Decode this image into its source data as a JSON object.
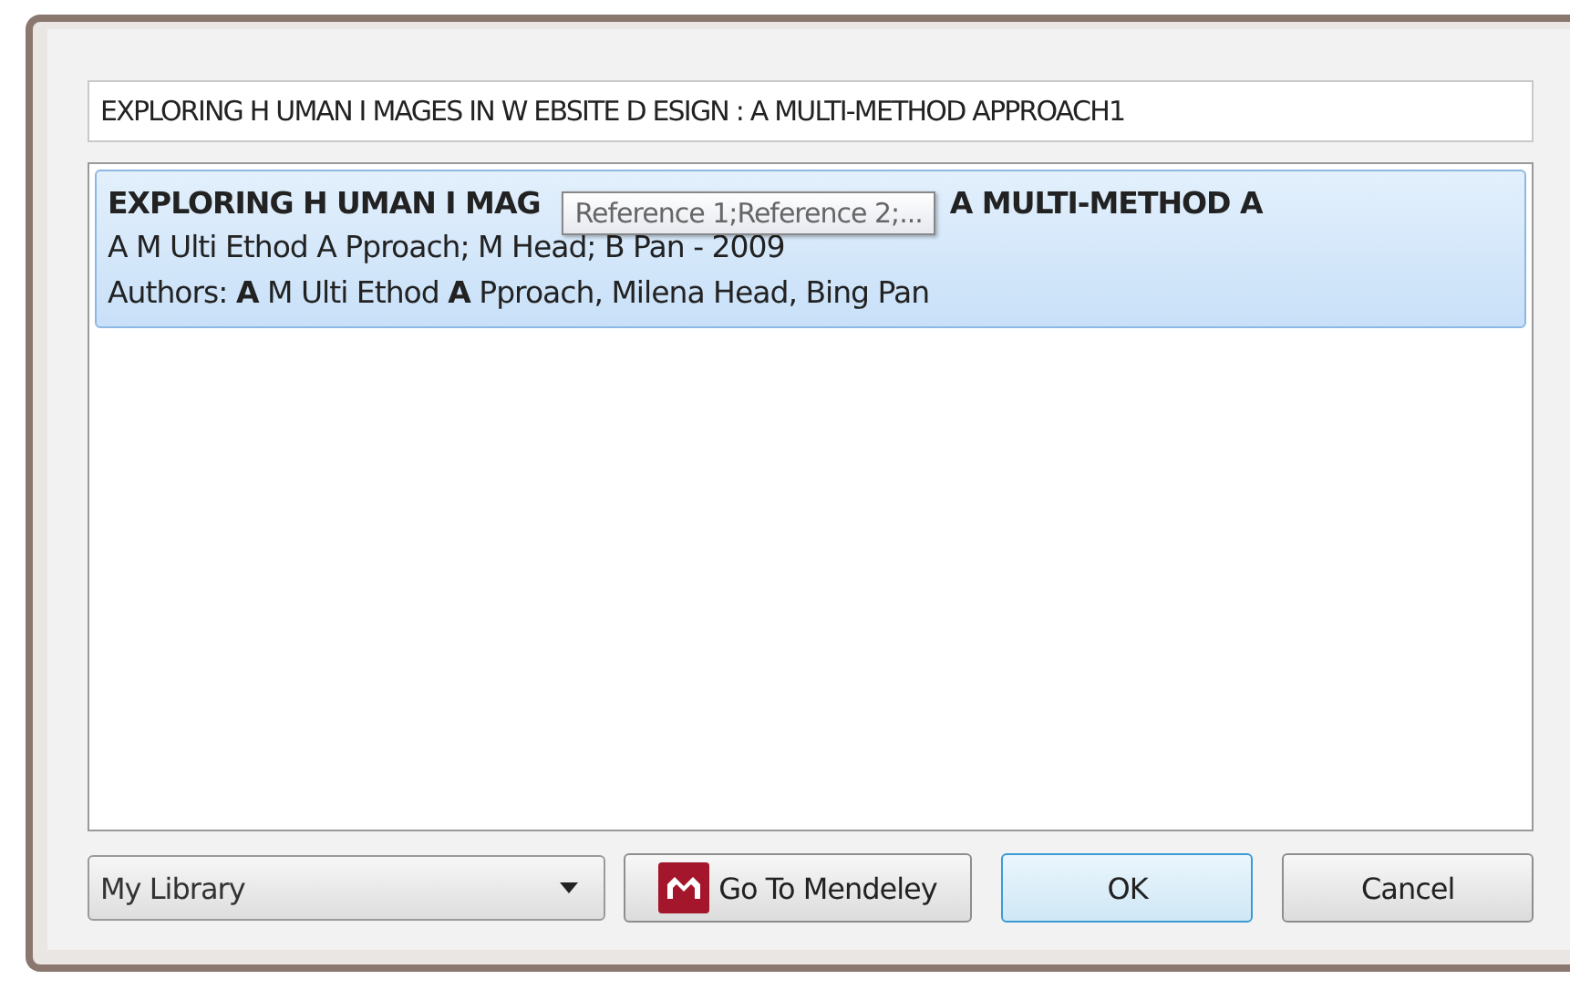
{
  "search_field": {
    "value": "EXPLORING H UMAN I MAGES IN W EBSITE D ESIGN : A MULTI-METHOD APPROACH1"
  },
  "results": [
    {
      "title_parts": [
        "EXPLORING H UMAN I MAG",
        "A MULTI-METHOD A"
      ],
      "citation": "A M Ulti Ethod A Pproach; M Head; B Pan - 2009",
      "authors": "Authors: **A** M Ulti Ethod **A** Pproach, Milena Head, Bing Pan",
      "selected": true
    }
  ],
  "tooltip": "Reference 1;Reference 2;...",
  "library_dropdown": {
    "value": "My Library"
  },
  "buttons": [
    {
      "kind": "mendeley",
      "label": "Go To Mendeley",
      "focused": false
    },
    {
      "kind": "plain",
      "label": "OK",
      "focused": true
    },
    {
      "kind": "plain",
      "label": "Cancel",
      "focused": false
    }
  ]
}
